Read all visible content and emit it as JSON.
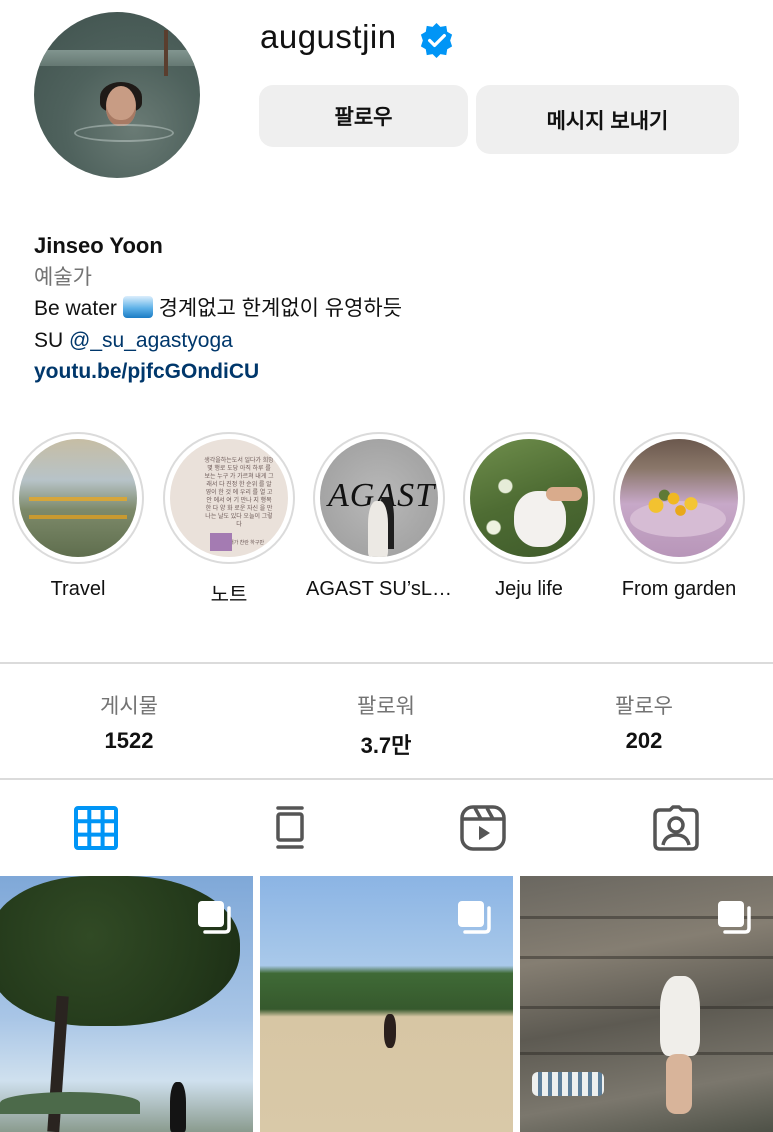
{
  "profile": {
    "username": "augustjin",
    "follow_button": "팔로우",
    "message_button": "메시지 보내기"
  },
  "bio": {
    "name": "Jinseo Yoon",
    "category": "예술가",
    "line1_pre": "Be water",
    "line1_post": "경계없고 한계없이 유영하듯",
    "line2_pre": "SU",
    "mention": "@_su_agastyoga",
    "link": "youtu.be/pjfcGOndiCU"
  },
  "highlights": [
    {
      "label": "Travel"
    },
    {
      "label": "노트",
      "note_text": "생각을하는도서 일다가 희망 몇 행로 도당 아직 하루 를 보는 누구 가 가르쳐 내게 그래서 다 진정 한 순위 를 알 영이 한 것 에 우리 를 열 고 안 에서 여 기 만나 지 행복 한 다 양 화 로운 자신 을 만나는 날도 있다 오늘이 그렇다",
      "note_footer": "오늘도 해가 찬란 하구만",
      "agast_word": "AGAST"
    },
    {
      "label": "AGAST SU’sL…"
    },
    {
      "label": "Jeju life"
    },
    {
      "label": "From garden"
    }
  ],
  "stats": [
    {
      "label": "게시물",
      "value": "1522"
    },
    {
      "label": "팔로워",
      "value": "3.7만"
    },
    {
      "label": "팔로우",
      "value": "202"
    }
  ],
  "tabs": [
    {
      "icon": "grid-icon",
      "active": true
    },
    {
      "icon": "feed-icon",
      "active": false
    },
    {
      "icon": "reels-icon",
      "active": false
    },
    {
      "icon": "tagged-icon",
      "active": false
    }
  ],
  "colors": {
    "accent": "#0095f6",
    "link": "#00376b",
    "muted": "#737373",
    "button_bg": "#efefef",
    "divider": "#dbdbdb"
  }
}
